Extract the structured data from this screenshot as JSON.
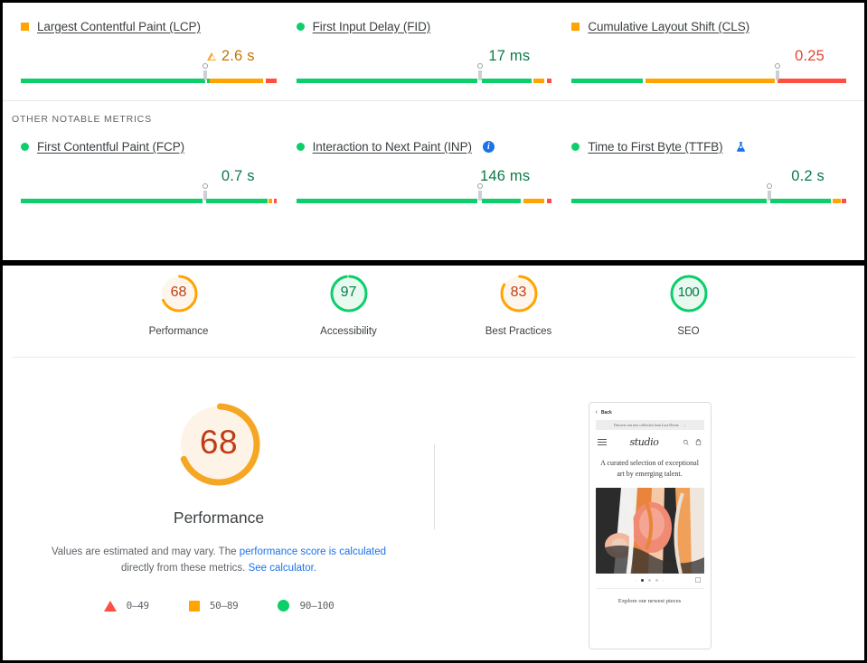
{
  "core_web_vitals": {
    "metrics": [
      {
        "id": "lcp",
        "title": "Largest Contentful Paint (LCP)",
        "status": "average",
        "marker_shape": "square",
        "value": "2.6 s",
        "value_state": "average",
        "has_warning_triangle": true,
        "has_info_icon": false,
        "has_flask_icon": false,
        "marker_pct": 72,
        "segments": [
          {
            "state": "good",
            "pct": 72
          },
          {
            "state": "gap",
            "pct": 1
          },
          {
            "state": "good",
            "pct": 1
          },
          {
            "state": "avg",
            "pct": 21
          },
          {
            "state": "gap",
            "pct": 1
          },
          {
            "state": "bad",
            "pct": 4
          }
        ]
      },
      {
        "id": "fid",
        "title": "First Input Delay (FID)",
        "status": "good",
        "marker_shape": "circle",
        "value": "17 ms",
        "value_state": "good",
        "has_warning_triangle": false,
        "has_info_icon": false,
        "has_flask_icon": false,
        "marker_pct": 72,
        "segments": [
          {
            "state": "good",
            "pct": 71
          },
          {
            "state": "gap",
            "pct": 1.5
          },
          {
            "state": "good",
            "pct": 19.5
          },
          {
            "state": "gap",
            "pct": 1
          },
          {
            "state": "avg",
            "pct": 4
          },
          {
            "state": "gap",
            "pct": 1
          },
          {
            "state": "bad",
            "pct": 2
          }
        ]
      },
      {
        "id": "cls",
        "title": "Cumulative Layout Shift (CLS)",
        "status": "average",
        "marker_shape": "square",
        "value": "0.25",
        "value_state": "bad",
        "has_warning_triangle": false,
        "has_info_icon": false,
        "has_flask_icon": false,
        "marker_pct": 75,
        "segments": [
          {
            "state": "good",
            "pct": 26
          },
          {
            "state": "gap",
            "pct": 1
          },
          {
            "state": "avg",
            "pct": 47
          },
          {
            "state": "gap",
            "pct": 1
          },
          {
            "state": "bad",
            "pct": 25
          }
        ]
      }
    ]
  },
  "other_metrics": {
    "section_label": "OTHER NOTABLE METRICS",
    "metrics": [
      {
        "id": "fcp",
        "title": "First Contentful Paint (FCP)",
        "status": "good",
        "marker_shape": "circle",
        "value": "0.7 s",
        "value_state": "good",
        "has_warning_triangle": false,
        "has_info_icon": false,
        "has_flask_icon": false,
        "marker_pct": 72,
        "segments": [
          {
            "state": "good",
            "pct": 71
          },
          {
            "state": "gap",
            "pct": 1.5
          },
          {
            "state": "good",
            "pct": 24
          },
          {
            "state": "gap",
            "pct": 0.5
          },
          {
            "state": "avg",
            "pct": 1.5
          },
          {
            "state": "gap",
            "pct": 0.5
          },
          {
            "state": "bad",
            "pct": 1
          }
        ]
      },
      {
        "id": "inp",
        "title": "Interaction to Next Paint (INP)",
        "status": "good",
        "marker_shape": "circle",
        "value": "146 ms",
        "value_state": "good",
        "has_warning_triangle": false,
        "has_info_icon": true,
        "has_flask_icon": false,
        "marker_pct": 72,
        "segments": [
          {
            "state": "good",
            "pct": 71
          },
          {
            "state": "gap",
            "pct": 1.5
          },
          {
            "state": "good",
            "pct": 15.5
          },
          {
            "state": "gap",
            "pct": 1
          },
          {
            "state": "avg",
            "pct": 8
          },
          {
            "state": "gap",
            "pct": 1
          },
          {
            "state": "bad",
            "pct": 2
          }
        ]
      },
      {
        "id": "ttfb",
        "title": "Time to First Byte (TTFB)",
        "status": "good",
        "marker_shape": "circle",
        "value": "0.2 s",
        "value_state": "good",
        "has_warning_triangle": false,
        "has_info_icon": false,
        "has_flask_icon": true,
        "marker_pct": 72,
        "segments": [
          {
            "state": "good",
            "pct": 71
          },
          {
            "state": "gap",
            "pct": 1.5
          },
          {
            "state": "good",
            "pct": 22
          },
          {
            "state": "gap",
            "pct": 0.5
          },
          {
            "state": "avg",
            "pct": 3
          },
          {
            "state": "gap",
            "pct": 0.5
          },
          {
            "state": "bad",
            "pct": 1.5
          }
        ]
      }
    ]
  },
  "scores": {
    "gauges": [
      {
        "label": "Performance",
        "score": "68",
        "value": 68,
        "state": "average"
      },
      {
        "label": "Accessibility",
        "score": "97",
        "value": 97,
        "state": "good"
      },
      {
        "label": "Best Practices",
        "score": "83",
        "value": 83,
        "state": "average"
      },
      {
        "label": "SEO",
        "score": "100",
        "value": 100,
        "state": "good"
      }
    ]
  },
  "performance_detail": {
    "score": "68",
    "value": 68,
    "state": "average",
    "title": "Performance",
    "description_part1": "Values are estimated and may vary. The ",
    "link1": "performance score is calculated",
    "description_part2": " directly from these metrics. ",
    "link2": "See calculator.",
    "legend": [
      {
        "shape": "triangle",
        "range": "0–49",
        "color": "#ff4e42"
      },
      {
        "shape": "square",
        "range": "50–89",
        "color": "#ffa400"
      },
      {
        "shape": "circle",
        "range": "90–100",
        "color": "#0cce6b"
      }
    ]
  },
  "screenshot_preview": {
    "back_label": "Back",
    "banner_text": "Discover our new collection from Luca Devon",
    "banner_arrow": "›",
    "logo": "studio",
    "hero_text": "A curated selection of exceptional art by emerging talent.",
    "footer_text": "Explore our newest pieces"
  },
  "colors": {
    "good": "#0cce6b",
    "average": "#ffa400",
    "bad": "#ff4e42",
    "good_text": "#0b7a47",
    "average_text": "#c27600",
    "bad_text": "#e8422f",
    "link": "#1a73e8",
    "gauge_good_fill": "#e8f9f0",
    "gauge_average_fill": "#fef6ec"
  }
}
